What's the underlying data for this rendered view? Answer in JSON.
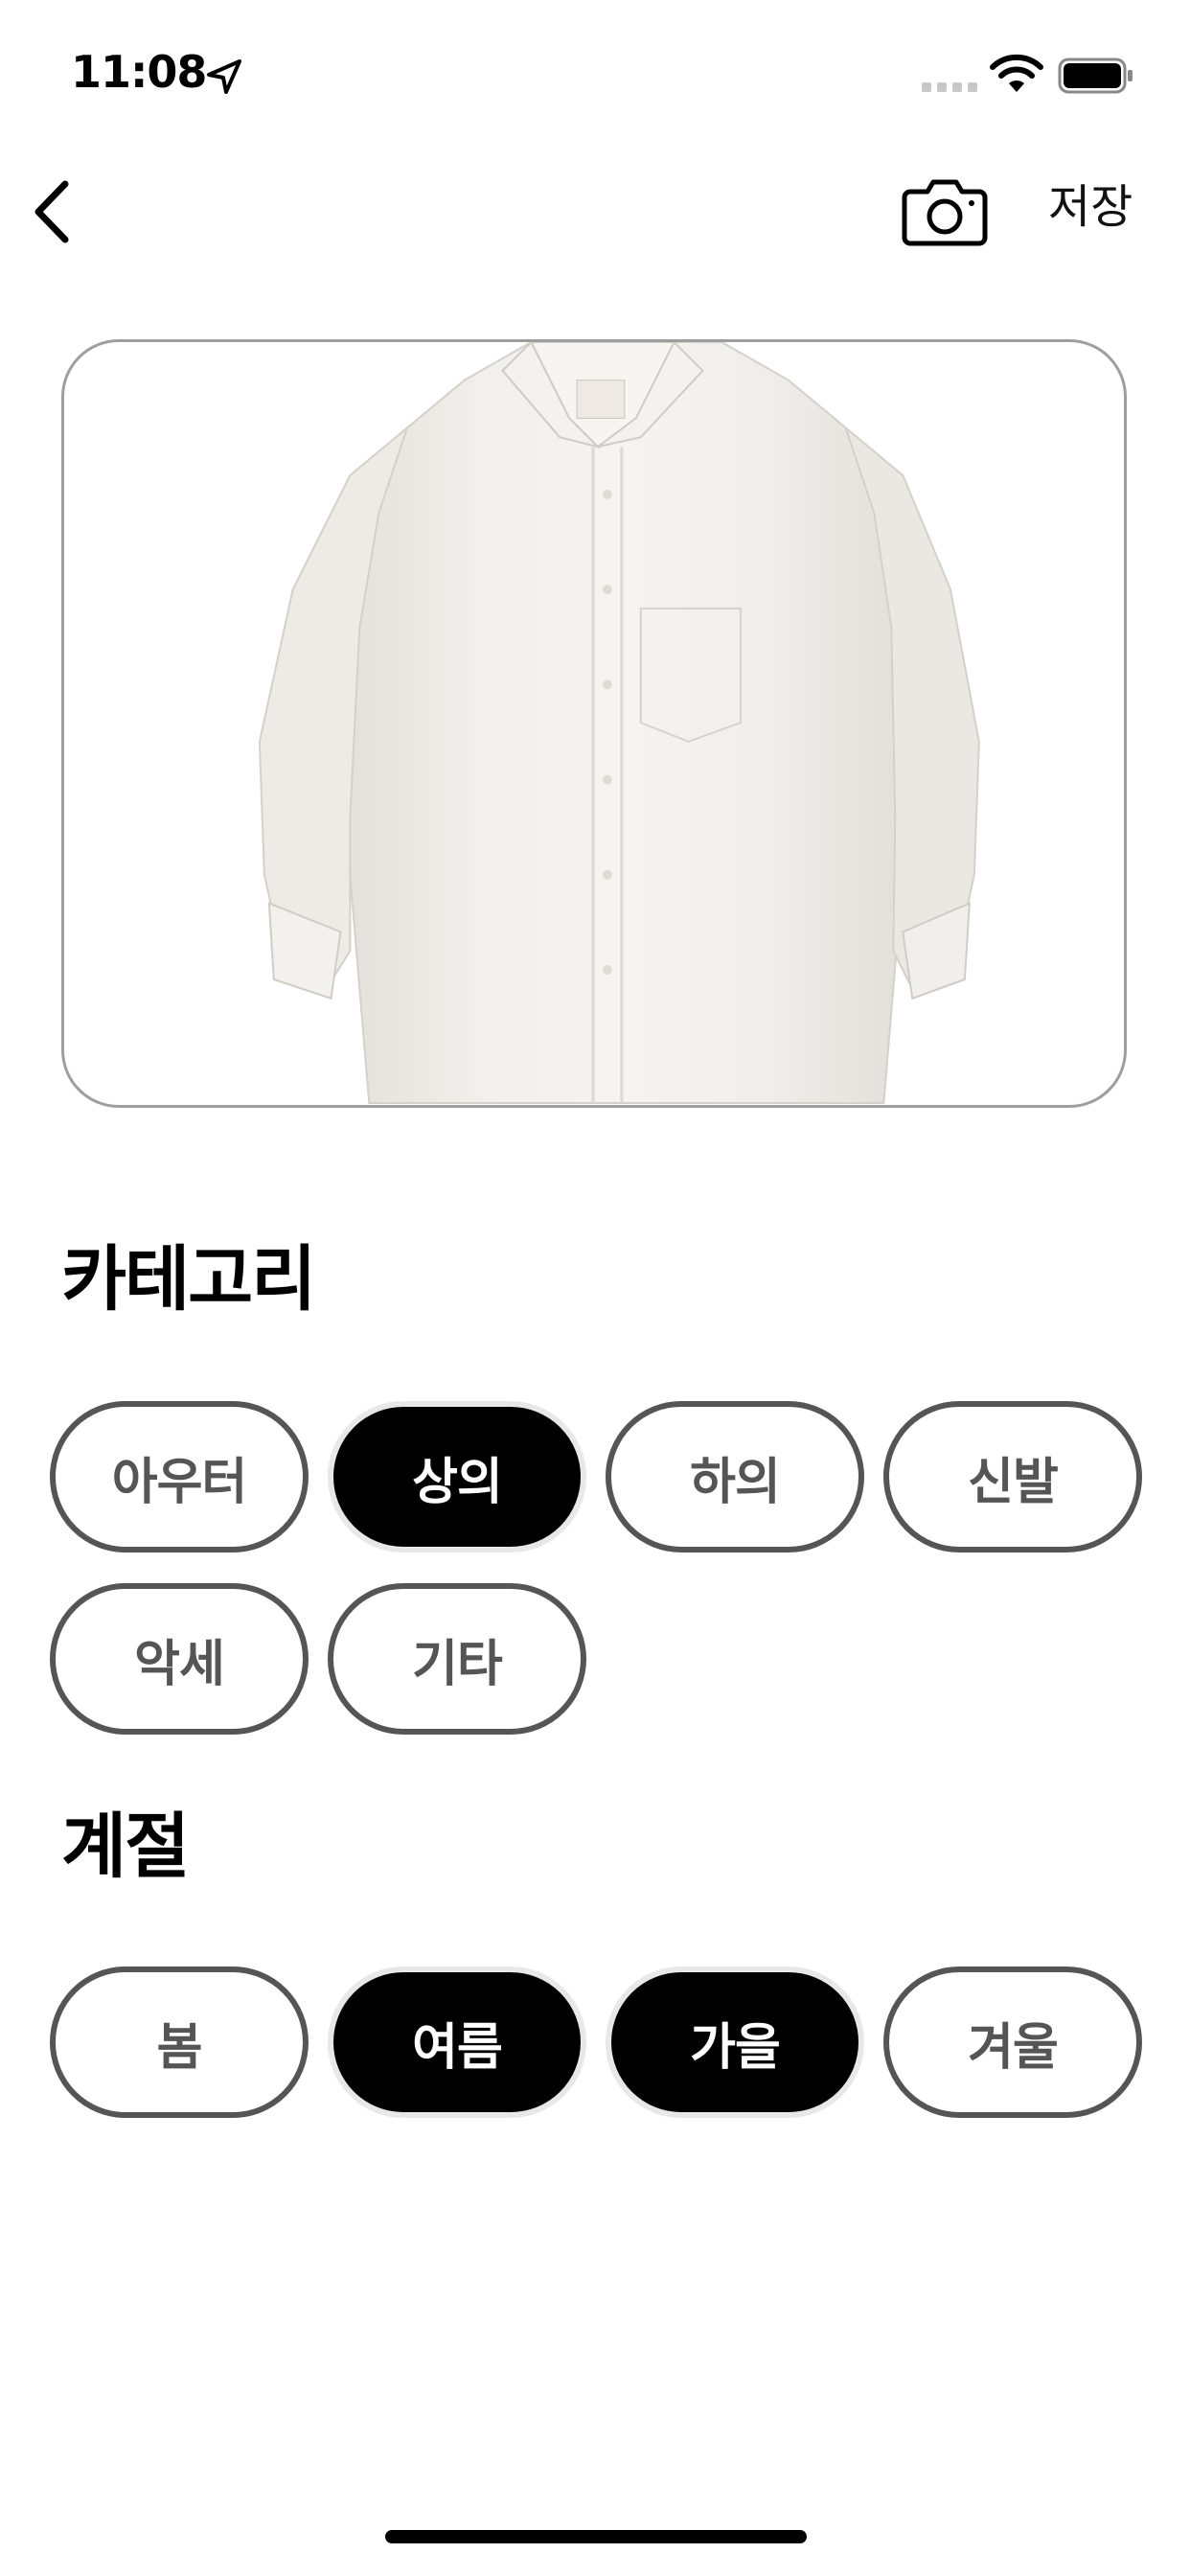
{
  "status_bar": {
    "time": "11:08"
  },
  "nav": {
    "save_label": "저장"
  },
  "category": {
    "title": "카테고리",
    "options": [
      {
        "label": "아우터",
        "selected": false
      },
      {
        "label": "상의",
        "selected": true
      },
      {
        "label": "하의",
        "selected": false
      },
      {
        "label": "신발",
        "selected": false
      },
      {
        "label": "악세",
        "selected": false
      },
      {
        "label": "기타",
        "selected": false
      }
    ]
  },
  "season": {
    "title": "계절",
    "options": [
      {
        "label": "봄",
        "selected": false
      },
      {
        "label": "여름",
        "selected": true
      },
      {
        "label": "가을",
        "selected": true
      },
      {
        "label": "겨울",
        "selected": false
      }
    ]
  },
  "colors": {
    "selected_bg": "#000000",
    "selected_text": "#ffffff",
    "unselected_border": "#555555",
    "unselected_text": "#555555"
  }
}
